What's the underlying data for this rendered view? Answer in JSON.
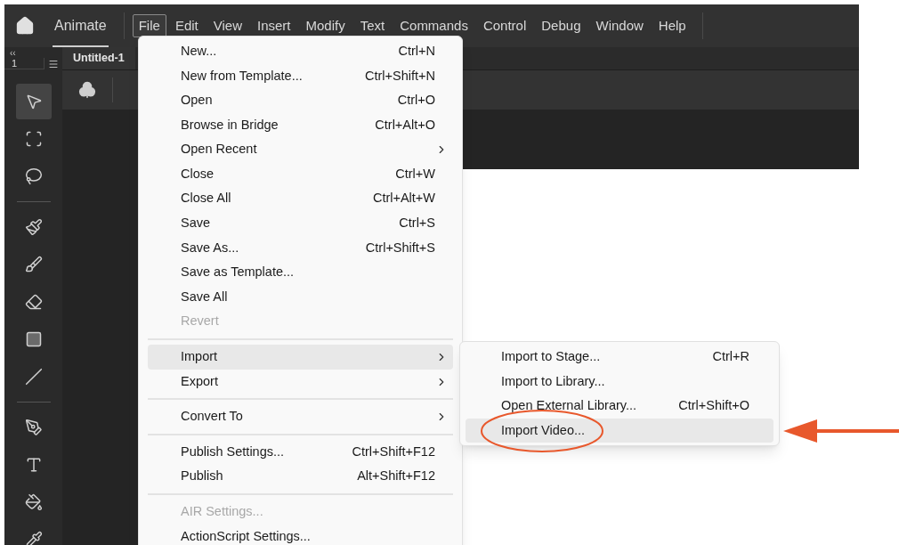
{
  "app": {
    "name": "Animate"
  },
  "menubar": [
    {
      "label": "File",
      "selected": true
    },
    {
      "label": "Edit",
      "selected": false
    },
    {
      "label": "View",
      "selected": false
    },
    {
      "label": "Insert",
      "selected": false
    },
    {
      "label": "Modify",
      "selected": false
    },
    {
      "label": "Text",
      "selected": false
    },
    {
      "label": "Commands",
      "selected": false
    },
    {
      "label": "Control",
      "selected": false
    },
    {
      "label": "Debug",
      "selected": false
    },
    {
      "label": "Window",
      "selected": false
    },
    {
      "label": "Help",
      "selected": false
    }
  ],
  "tools_panel": {
    "collapse": "‹‹",
    "value": "1"
  },
  "tools": [
    {
      "kind": "select",
      "selected": true
    },
    {
      "kind": "transform",
      "selected": false
    },
    {
      "kind": "lasso",
      "selected": false
    },
    {
      "kind": "separator"
    },
    {
      "kind": "brush-fill",
      "selected": false
    },
    {
      "kind": "brush",
      "selected": false
    },
    {
      "kind": "eraser",
      "selected": false
    },
    {
      "kind": "rectangle",
      "selected": false
    },
    {
      "kind": "line",
      "selected": false
    },
    {
      "kind": "separator"
    },
    {
      "kind": "pen",
      "selected": false
    },
    {
      "kind": "text",
      "selected": false
    },
    {
      "kind": "bucket",
      "selected": false
    },
    {
      "kind": "dropper",
      "selected": false
    }
  ],
  "document_tab": {
    "label": "Untitled-1"
  },
  "file_menu": [
    {
      "kind": "item",
      "label": "New...",
      "shortcut": "Ctrl+N",
      "disabled": false,
      "selected": false,
      "submenu": false
    },
    {
      "kind": "item",
      "label": "New from Template...",
      "shortcut": "Ctrl+Shift+N",
      "disabled": false,
      "selected": false,
      "submenu": false
    },
    {
      "kind": "item",
      "label": "Open",
      "shortcut": "Ctrl+O",
      "disabled": false,
      "selected": false,
      "submenu": false
    },
    {
      "kind": "item",
      "label": "Browse in Bridge",
      "shortcut": "Ctrl+Alt+O",
      "disabled": false,
      "selected": false,
      "submenu": false
    },
    {
      "kind": "item",
      "label": "Open Recent",
      "disabled": false,
      "selected": false,
      "submenu": true
    },
    {
      "kind": "item",
      "label": "Close",
      "shortcut": "Ctrl+W",
      "disabled": false,
      "selected": false,
      "submenu": false
    },
    {
      "kind": "item",
      "label": "Close All",
      "shortcut": "Ctrl+Alt+W",
      "disabled": false,
      "selected": false,
      "submenu": false
    },
    {
      "kind": "item",
      "label": "Save",
      "shortcut": "Ctrl+S",
      "disabled": false,
      "selected": false,
      "submenu": false
    },
    {
      "kind": "item",
      "label": "Save As...",
      "shortcut": "Ctrl+Shift+S",
      "disabled": false,
      "selected": false,
      "submenu": false
    },
    {
      "kind": "item",
      "label": "Save as Template...",
      "disabled": false,
      "selected": false,
      "submenu": false
    },
    {
      "kind": "item",
      "label": "Save All",
      "disabled": false,
      "selected": false,
      "submenu": false
    },
    {
      "kind": "item",
      "label": "Revert",
      "disabled": true,
      "selected": false,
      "submenu": false
    },
    {
      "kind": "separator"
    },
    {
      "kind": "item",
      "label": "Import",
      "disabled": false,
      "selected": true,
      "submenu": true
    },
    {
      "kind": "item",
      "label": "Export",
      "disabled": false,
      "selected": false,
      "submenu": true
    },
    {
      "kind": "separator"
    },
    {
      "kind": "item",
      "label": "Convert To",
      "disabled": false,
      "selected": false,
      "submenu": true
    },
    {
      "kind": "separator"
    },
    {
      "kind": "item",
      "label": "Publish Settings...",
      "shortcut": "Ctrl+Shift+F12",
      "disabled": false,
      "selected": false,
      "submenu": false
    },
    {
      "kind": "item",
      "label": "Publish",
      "shortcut": "Alt+Shift+F12",
      "disabled": false,
      "selected": false,
      "submenu": false
    },
    {
      "kind": "separator"
    },
    {
      "kind": "item",
      "label": "AIR Settings...",
      "disabled": true,
      "selected": false,
      "submenu": false
    },
    {
      "kind": "item",
      "label": "ActionScript Settings...",
      "disabled": false,
      "selected": false,
      "submenu": false
    }
  ],
  "import_submenu": [
    {
      "label": "Import to Stage...",
      "shortcut": "Ctrl+R",
      "selected": false
    },
    {
      "label": "Import to Library...",
      "selected": false
    },
    {
      "label": "Open External Library...",
      "shortcut": "Ctrl+Shift+O",
      "selected": false
    },
    {
      "label": "Import Video...",
      "selected": true
    }
  ],
  "annotations": [
    {
      "kind": "ellipse",
      "color": "#e8582c"
    },
    {
      "kind": "arrow",
      "color": "#e8582c"
    }
  ]
}
